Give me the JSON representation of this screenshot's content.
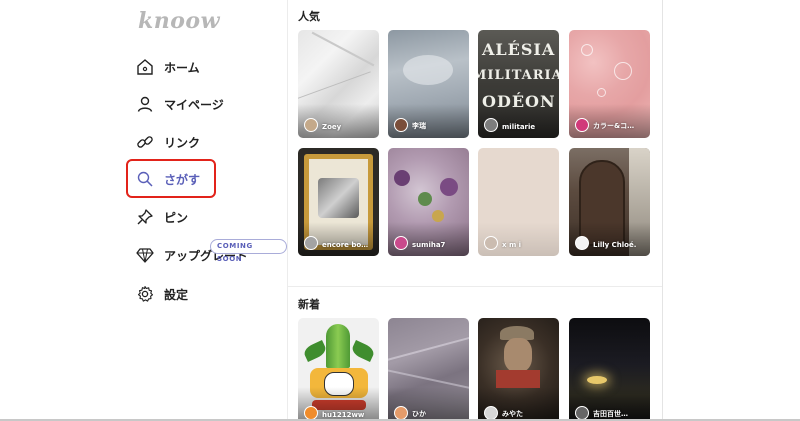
{
  "app": {
    "logo": "knoow"
  },
  "sidebar": {
    "items": [
      {
        "label": "ホーム",
        "icon": "home-icon"
      },
      {
        "label": "マイページ",
        "icon": "user-icon"
      },
      {
        "label": "リンク",
        "icon": "link-icon"
      },
      {
        "label": "さがす",
        "icon": "search-icon",
        "active": true
      },
      {
        "label": "ピン",
        "icon": "pin-icon"
      },
      {
        "label": "アップグレード",
        "icon": "diamond-icon",
        "badge": "COMING SOON"
      },
      {
        "label": "設定",
        "icon": "gear-icon"
      }
    ]
  },
  "colors": {
    "accent": "#5a5fb8",
    "highlight": "#e2231a"
  },
  "sections": [
    {
      "title": "人気",
      "cards": [
        {
          "author": "Zoey"
        },
        {
          "author": "李瑞"
        },
        {
          "author": "militarie",
          "overlay_text": [
            "ALÉSIA",
            "MILITARIA",
            "ODÉON"
          ]
        },
        {
          "author": "カラー&コ…"
        },
        {
          "author": "encore bo…"
        },
        {
          "author": "sumiha7"
        },
        {
          "author": "x m i"
        },
        {
          "author": "Lilly Chloé."
        }
      ]
    },
    {
      "title": "新着",
      "cards": [
        {
          "author": "hu1212ww"
        },
        {
          "author": "ひか"
        },
        {
          "author": "みやた"
        },
        {
          "author": "吉田百世…"
        }
      ]
    }
  ]
}
